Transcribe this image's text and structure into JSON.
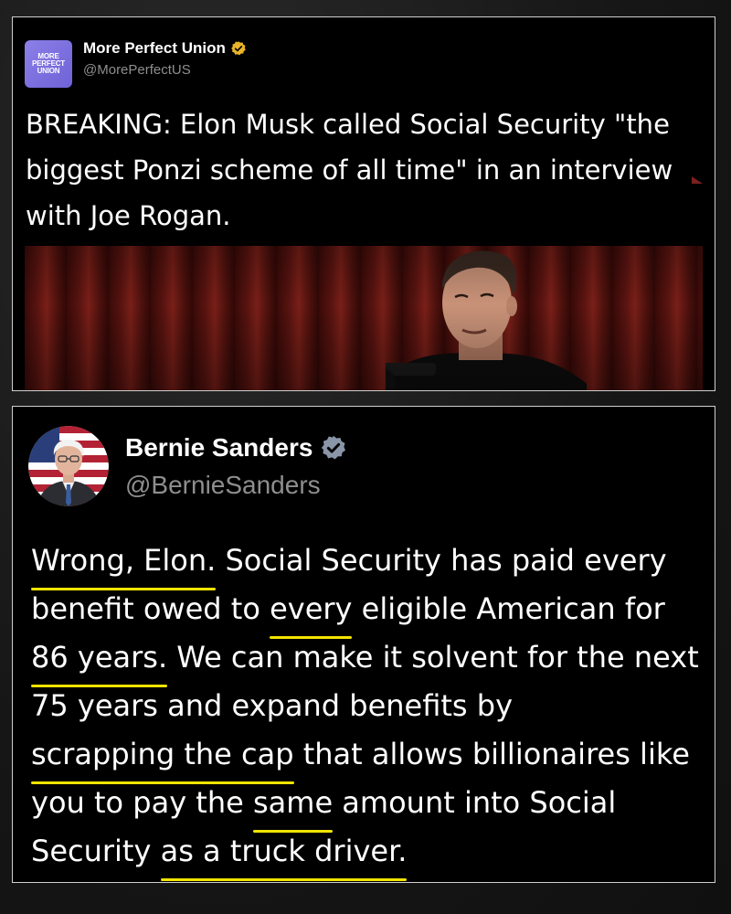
{
  "tweet1": {
    "avatar_text": [
      "MORE",
      "PERFECT",
      "UNION"
    ],
    "display_name": "More Perfect Union",
    "handle": "@MorePerfectUS",
    "verified_badge": "gold-check-badge-icon",
    "text": "BREAKING: Elon Musk called Social Security \"the biggest Ponzi scheme of all time\" in an interview with Joe Rogan."
  },
  "tweet2": {
    "display_name": "Bernie Sanders",
    "handle": "@BernieSanders",
    "verified_badge": "gray-check-badge-icon",
    "text": {
      "p1": "Wrong, Elon.",
      "p2": " Social Security has paid every benefit owed to ",
      "p3": "every",
      "p4": " eligible American for ",
      "p5": "86 years.",
      "p6": " We can make it solvent for the next 75 years and expand benefits by ",
      "p7": "scrapping the cap",
      "p8": " that allows billionaires like you to pay the ",
      "p9": "same",
      "p10": " amount into Social Security ",
      "p11": "as a truck driver."
    }
  },
  "colors": {
    "highlight_underline": "#f1e400",
    "handle_gray": "#8e8e8e",
    "card_border": "#cfcfcf",
    "mpu_purple": "#7a6de0",
    "gold_badge": "#e8b42a"
  }
}
